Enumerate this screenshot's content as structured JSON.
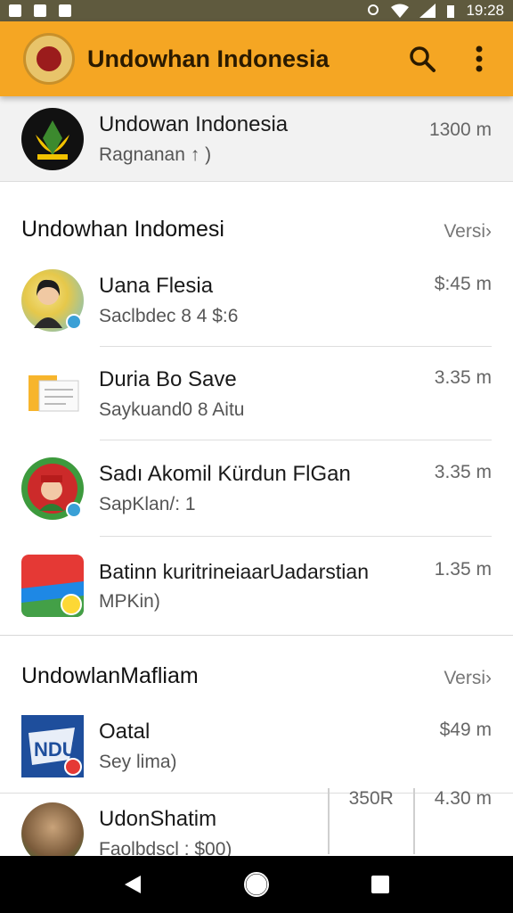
{
  "status_bar": {
    "time": "19:28"
  },
  "app_bar": {
    "title": "Undowhan Indonesia"
  },
  "top_card": {
    "title": "Undowan Indonesia",
    "subtitle": "Ragnanan ↑ )",
    "meta": "1300 m"
  },
  "sections": [
    {
      "title": "Undowhan Indomesi",
      "link": "Versi",
      "items": [
        {
          "title": "Uana Flesia",
          "subtitle": "Saclbdec 8 4 $:6",
          "meta": "$:45 m"
        },
        {
          "title": "Duria Bo Save",
          "subtitle": "Saykuand0 8 Aitu",
          "meta": "3.35 m"
        },
        {
          "title": "Sadı Akomil Kürdun FlGan",
          "subtitle": "SapKlan/: 1",
          "meta": "3.35 m"
        },
        {
          "title": "Batinn kuritrineiaarUadarstian",
          "subtitle": "MPKin)",
          "meta": "1.35 m"
        }
      ]
    },
    {
      "title": "UndowlanMafliam",
      "link": "Versi",
      "items": [
        {
          "title": "Oatal",
          "subtitle": "Sey lima)",
          "meta": "$49 m"
        }
      ]
    }
  ],
  "bottom_row": {
    "title": "UdonShatim",
    "subtitle": "Faolbdscl : $00)",
    "col1": "350R",
    "col2": "4.30 m"
  },
  "colors": {
    "app_bar": "#f5a623",
    "status_bar": "#5f5a3e",
    "nav_bar": "#000000"
  },
  "icons": {
    "search": "search-icon",
    "more": "more-vert-icon",
    "back": "back-triangle-icon",
    "home": "home-circle-icon",
    "recents": "recents-square-icon"
  }
}
